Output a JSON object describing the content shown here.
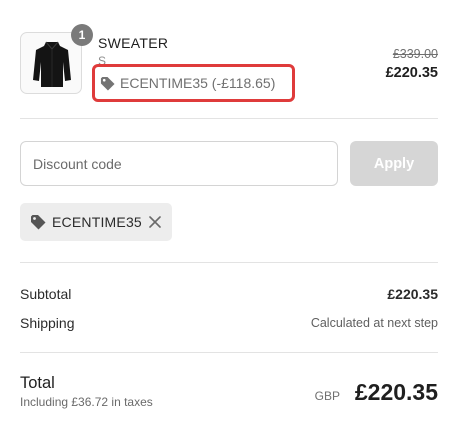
{
  "product": {
    "name": "SWEATER",
    "variant": "S",
    "quantity": "1",
    "applied_code_label": "ECENTIME35 (-£118.65)",
    "original_price": "£339.00",
    "current_price": "£220.35"
  },
  "discount_form": {
    "placeholder": "Discount code",
    "value": "",
    "apply_label": "Apply"
  },
  "discount_chip": {
    "code": "ECENTIME35"
  },
  "summary": {
    "subtotal_label": "Subtotal",
    "subtotal_value": "£220.35",
    "shipping_label": "Shipping",
    "shipping_value": "Calculated at next step"
  },
  "total": {
    "label": "Total",
    "tax_note": "Including £36.72 in taxes",
    "currency": "GBP",
    "value": "£220.35"
  },
  "colors": {
    "highlight_border": "#df3b3b",
    "apply_button_disabled": "#d6d6d6",
    "chip_background": "#ededed",
    "quantity_badge": "#7a7a7a"
  },
  "icons": {
    "tag": "tag-icon",
    "close": "close-icon",
    "product_image": "sweater-image"
  }
}
